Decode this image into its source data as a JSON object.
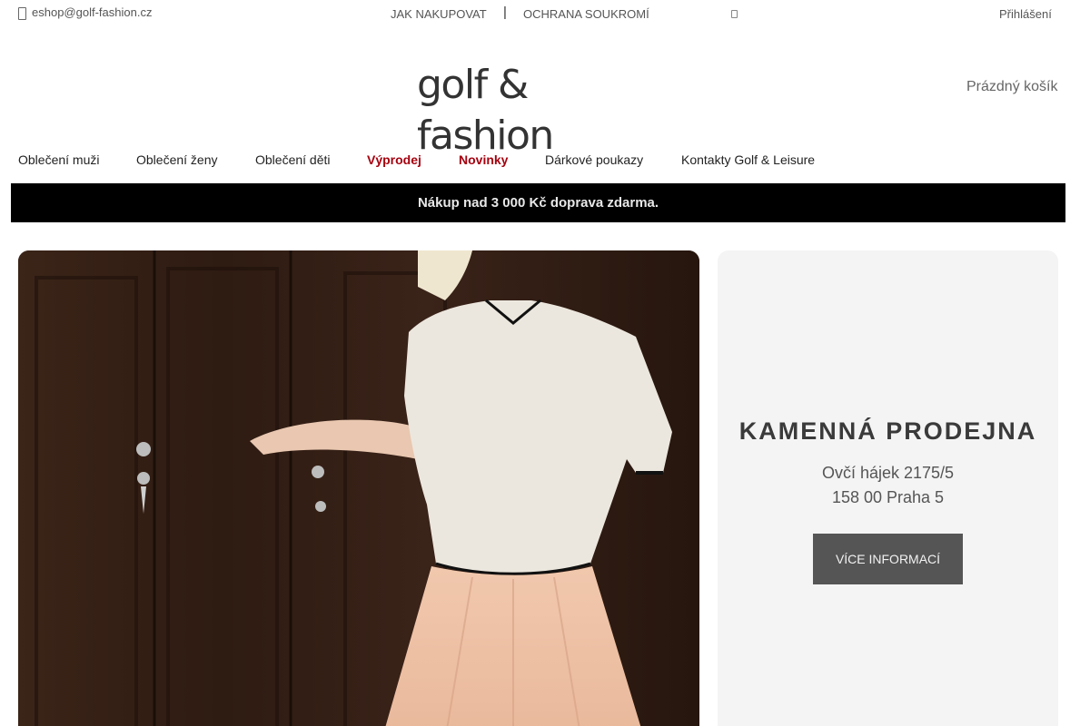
{
  "topbar": {
    "email": "eshop@golf-fashion.cz",
    "links": [
      "JAK NAKUPOVAT",
      "OCHRANA SOUKROMÍ"
    ],
    "separator": "|",
    "login": "Přihlášení"
  },
  "header": {
    "logo_text": "golf & fashion",
    "cart": "Prázdný košík"
  },
  "nav": {
    "items": [
      {
        "label": "Oblečení muži"
      },
      {
        "label": "Oblečení ženy"
      },
      {
        "label": "Oblečení děti"
      },
      {
        "label": "Výprodej"
      },
      {
        "label": "Novinky"
      },
      {
        "label": "Dárkové poukazy"
      },
      {
        "label": "Kontakty Golf & Leisure"
      }
    ]
  },
  "promo": {
    "text": "Nákup nad 3 000 Kč doprava zdarma."
  },
  "store": {
    "title": "KAMENNÁ PRODEJNA",
    "address_line1": "Ovčí hájek 2175/5",
    "address_line2": "158 00 Praha 5",
    "button": "VÍCE INFORMACÍ"
  },
  "colors": {
    "accent": "#a5000f",
    "promo_bg": "#000000",
    "store_bg": "#f4f4f4",
    "button_bg": "#555555"
  },
  "icons": [
    "mail-icon",
    "search-icon"
  ]
}
